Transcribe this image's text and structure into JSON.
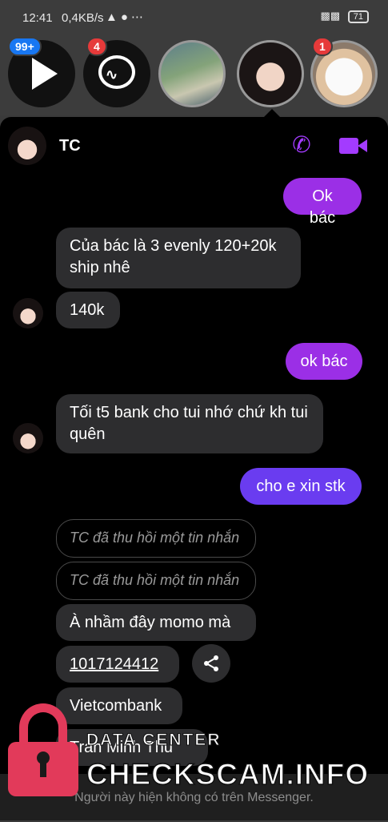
{
  "status_bar": {
    "time": "12:41",
    "net_speed": "0,4KB/s",
    "signal": "4G",
    "battery": "71"
  },
  "chat_heads": [
    {
      "name": "video-player",
      "badge": "99+"
    },
    {
      "name": "messenger",
      "badge": "4"
    },
    {
      "name": "person-1",
      "badge": ""
    },
    {
      "name": "person-2",
      "badge": ""
    },
    {
      "name": "cat",
      "badge": "1"
    }
  ],
  "conversation": {
    "contact_name": "TC",
    "accent_color": "#a33bff",
    "messages": [
      {
        "direction": "out",
        "text": "Ok bác"
      },
      {
        "direction": "in",
        "text": "Của bác là 3 evenly 120+20k ship nhê"
      },
      {
        "direction": "in",
        "text": "140k"
      },
      {
        "direction": "out",
        "text": "ok bác"
      },
      {
        "direction": "in",
        "text": "Tối t5 bank cho tui nhớ chứ kh tui quên"
      },
      {
        "direction": "out",
        "text": "cho e xin stk"
      },
      {
        "direction": "in",
        "text": "TC đã thu hồi một tin nhắn",
        "revoked": true
      },
      {
        "direction": "in",
        "text": "TC đã thu hồi một tin nhắn",
        "revoked": true
      },
      {
        "direction": "in",
        "text": "À nhầm đây momo mà"
      },
      {
        "direction": "in",
        "text": "1017124412"
      },
      {
        "direction": "in",
        "text": "Vietcombank"
      },
      {
        "direction": "in",
        "text": "Tran Minh Thu"
      }
    ]
  },
  "footer": {
    "notice": "Người này hiện không có trên Messenger."
  },
  "watermark": {
    "line1": "DATA CENTER",
    "line2": "CHECKSCAM.INFO"
  }
}
